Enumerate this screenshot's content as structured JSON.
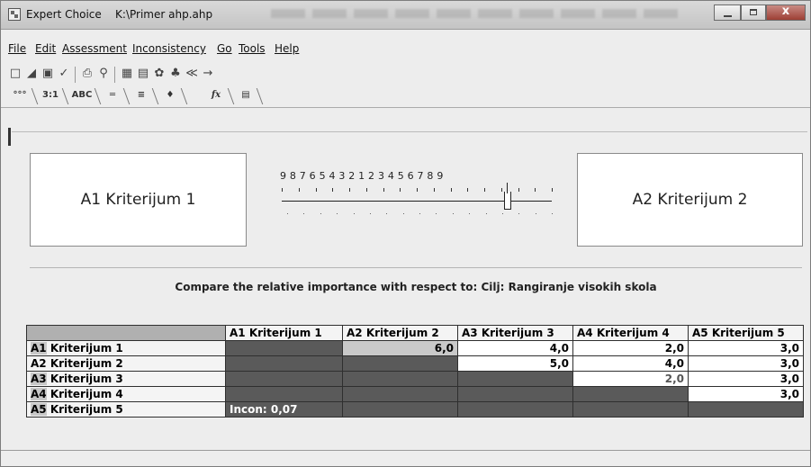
{
  "window": {
    "app_name": "Expert Choice",
    "file_path": "K:\\Primer ahp.ahp",
    "close_label": "x"
  },
  "menu": [
    "File",
    "Edit",
    "Assessment",
    "Inconsistency",
    "Go",
    "Tools",
    "Help"
  ],
  "toolbar_icons": [
    "new-file-icon",
    "open-folder-icon",
    "save-icon",
    "edit-icon",
    "print-icon",
    "print-preview-icon",
    "calculator-icon",
    "chart-icon",
    "settings-icon",
    "tree-icon",
    "check-icon",
    "arrow-icon"
  ],
  "tabs": [
    {
      "icon": "tree-tab-icon",
      "label": "°°°"
    },
    {
      "label": "3:1"
    },
    {
      "label": "ABC"
    },
    {
      "label": "═"
    },
    {
      "label": "≡"
    },
    {
      "label": "♦"
    },
    {
      "label": "fx"
    },
    {
      "label": "▤"
    }
  ],
  "comparison": {
    "left": "A1 Kriterijum 1",
    "right": "A2 Kriterijum 2",
    "scale_numbers": "9 8 7 6 5 4 3 2 1 2 3 4 5 6 7 8 9",
    "prompt": "Compare the relative importance with respect to: Cilj: Rangiranje visokih skola"
  },
  "matrix": {
    "columns": [
      "A1 Kriterijum 1",
      "A2 Kriterijum 2",
      "A3 Kriterijum 3",
      "A4 Kriterijum 4",
      "A5 Kriterijum 5"
    ],
    "rows": [
      {
        "prefix": "A1",
        "label": " Kriterijum 1",
        "cells": [
          "",
          "6,0",
          "4,0",
          "2,0",
          "3,0"
        ]
      },
      {
        "prefix": "A2",
        "label": " Kriterijum 2",
        "cells": [
          "",
          "",
          "5,0",
          "4,0",
          "3,0"
        ]
      },
      {
        "prefix": "A3",
        "label": " Kriterijum 3",
        "cells": [
          "",
          "",
          "",
          "2,0",
          "3,0"
        ]
      },
      {
        "prefix": "A4",
        "label": " Kriterijum 4",
        "cells": [
          "",
          "",
          "",
          "",
          "3,0"
        ]
      },
      {
        "prefix": "A5",
        "label": " Kriterijum 5",
        "cells": [
          "",
          "",
          "",
          "",
          ""
        ]
      }
    ],
    "inconsistency": "Incon: 0,07"
  }
}
